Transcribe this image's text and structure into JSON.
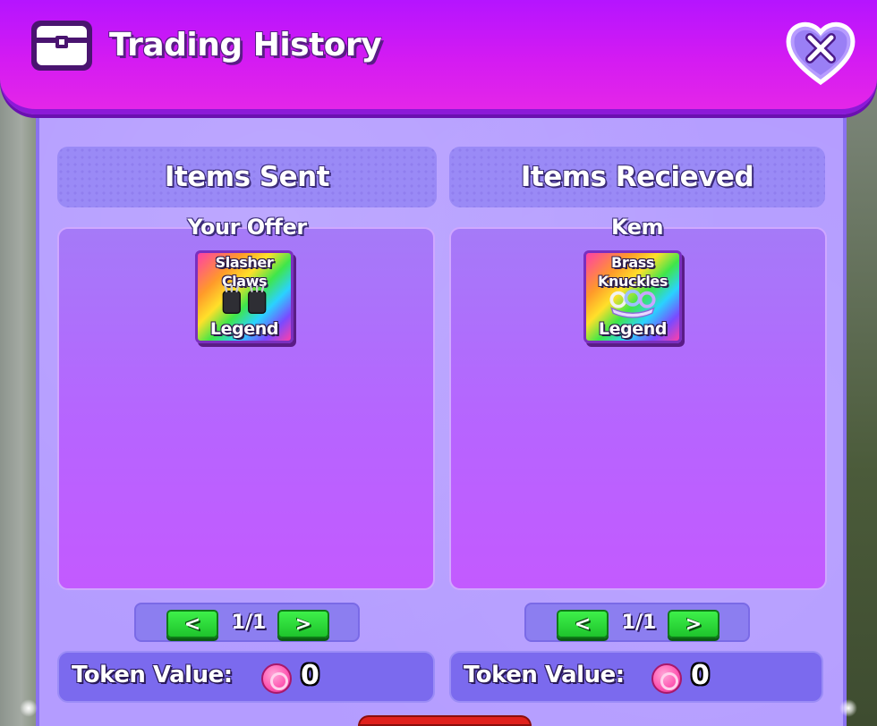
{
  "header": {
    "title": "Trading History",
    "icon": "chest-icon",
    "close_icon": "close-x-heart-icon"
  },
  "sent": {
    "heading": "Items Sent",
    "owner": "Your Offer",
    "items": [
      {
        "name": "Slasher Claws",
        "rarity": "Legend",
        "icon": "claws-icon"
      }
    ],
    "pager": {
      "prev": "<",
      "count": "1/1",
      "next": ">"
    },
    "token_label": "Token Value:",
    "token_value": "0"
  },
  "received": {
    "heading": "Items Recieved",
    "owner": "Kem",
    "items": [
      {
        "name": "Brass Knuckles",
        "rarity": "Legend",
        "icon": "brass-knuckles-icon"
      }
    ],
    "pager": {
      "prev": "<",
      "count": "1/1",
      "next": ">"
    },
    "token_label": "Token Value:",
    "token_value": "0"
  },
  "colors": {
    "header": "#d41bf2",
    "panel": "#b49cff",
    "box": "#b764ff",
    "pager_button": "#1ec42c",
    "token_icon": "#ff5ab4"
  }
}
